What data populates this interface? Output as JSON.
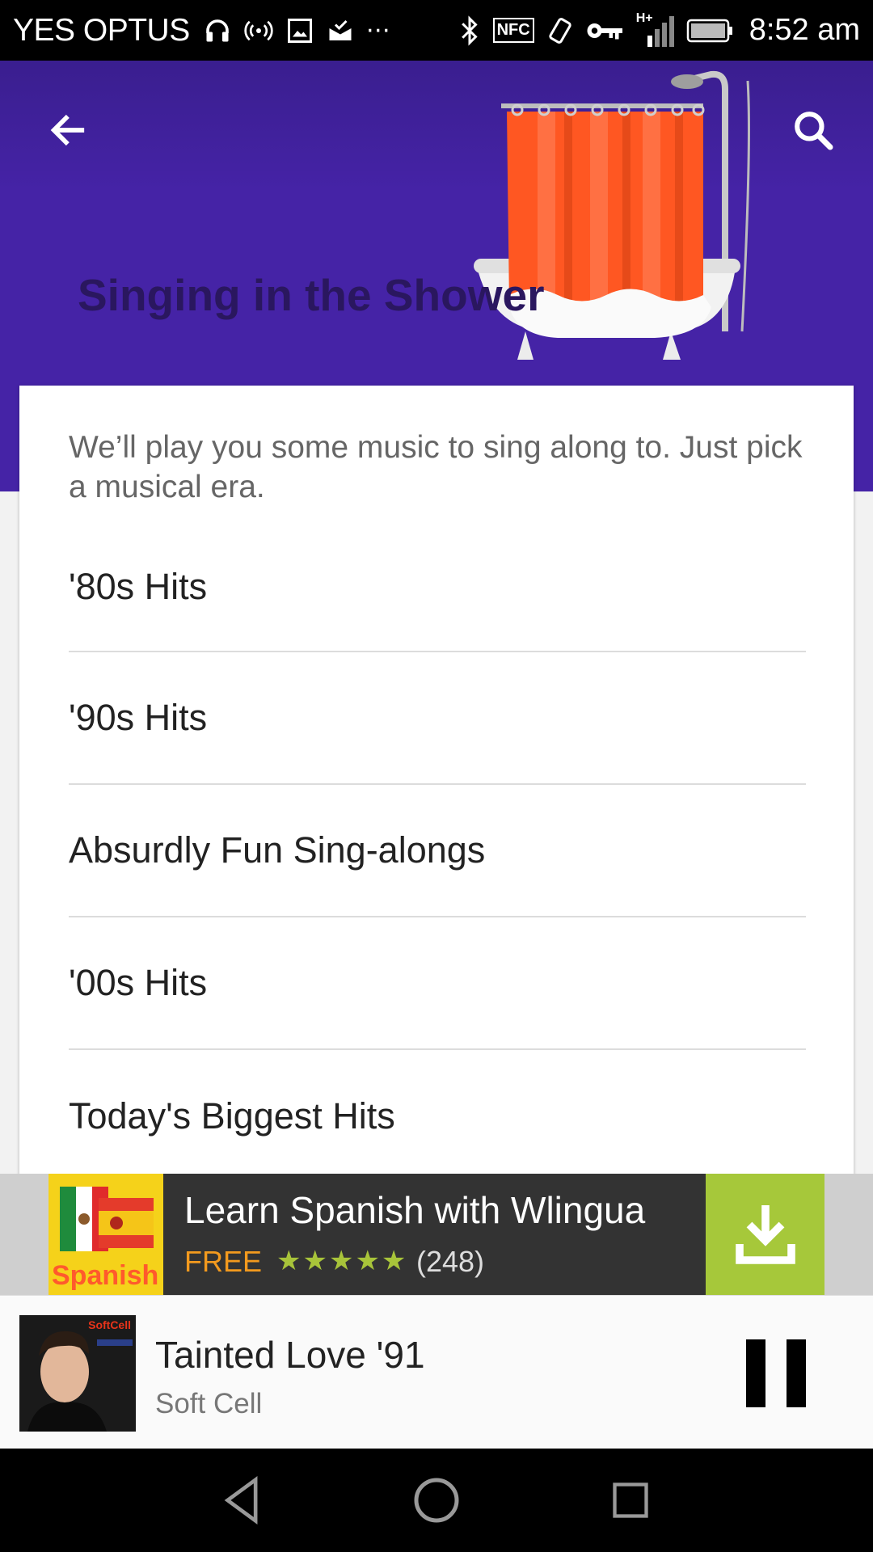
{
  "status_bar": {
    "carrier": "YES OPTUS",
    "nfc_label": "NFC",
    "network_label": "H+",
    "time": "8:52 am"
  },
  "header": {
    "title": "Singing in the Shower",
    "background_color": "#4523a6",
    "title_color": "#2a175f"
  },
  "card": {
    "intro": "We’ll play you some music to sing along to. Just pick a musical era.",
    "items": [
      {
        "label": "'80s Hits"
      },
      {
        "label": "'90s Hits"
      },
      {
        "label": "Absurdly Fun Sing-alongs"
      },
      {
        "label": "'00s Hits"
      },
      {
        "label": "Today's Biggest Hits"
      }
    ]
  },
  "ad": {
    "logo_text": "Spanish",
    "title": "Learn Spanish with Wlingua",
    "price": "FREE",
    "rating": 4.5,
    "stars": "★★★★★",
    "reviews": "(248)",
    "accent_color": "#a6c83a"
  },
  "now_playing": {
    "title": "Tainted Love '91",
    "artist": "Soft Cell",
    "album_badge": "SoftCell"
  }
}
